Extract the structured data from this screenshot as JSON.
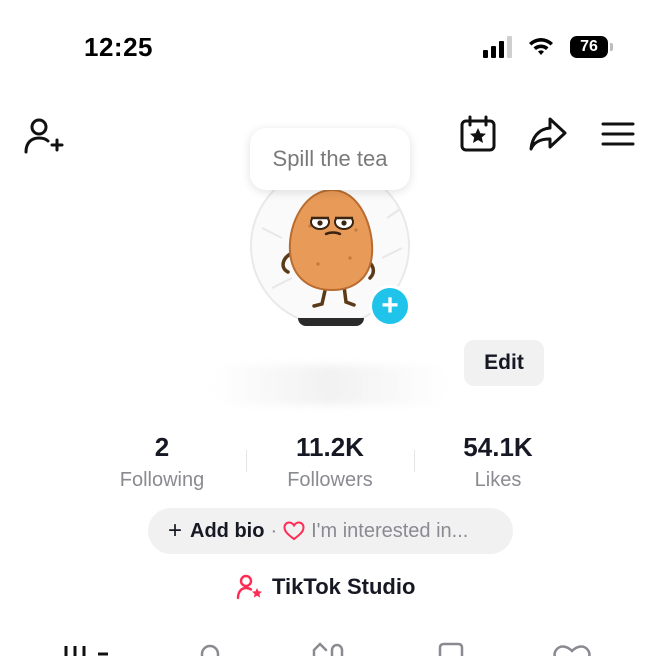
{
  "status": {
    "time": "12:25",
    "battery": "76",
    "icons": [
      "signal-icon",
      "wifi-icon",
      "battery-icon"
    ]
  },
  "nav": {
    "left_icon": "add-friend-icon",
    "right_icons": [
      "calendar-star-icon",
      "share-icon",
      "menu-icon"
    ]
  },
  "profile": {
    "tooltip": "Spill the tea",
    "edit_label": "Edit"
  },
  "stats": [
    {
      "value": "2",
      "label": "Following"
    },
    {
      "value": "11.2K",
      "label": "Followers"
    },
    {
      "value": "54.1K",
      "label": "Likes"
    }
  ],
  "bio": {
    "add_label": "Add bio",
    "separator": "·",
    "interest_label": "I'm interested in..."
  },
  "studio": {
    "label": "TikTok Studio"
  },
  "colors": {
    "accent_blue": "#20c4ea",
    "accent_pink": "#fe2c55",
    "text_primary": "#161823",
    "text_secondary": "#8a8b91",
    "pill_bg": "#f1f1f2"
  }
}
